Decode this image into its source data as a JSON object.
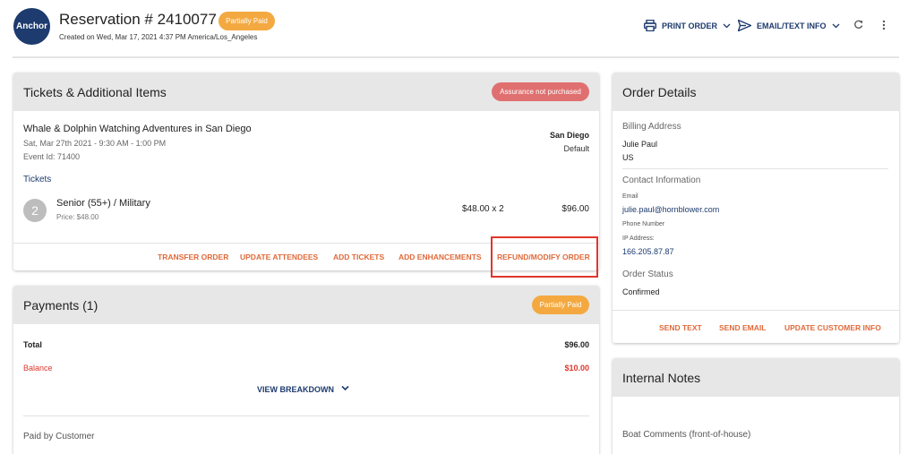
{
  "header": {
    "logo_text": "Anchor",
    "title": "Reservation # 2410077",
    "status_badge": "Partially Paid",
    "created": "Created on Wed, Mar 17, 2021 4:37 PM America/Los_Angeles",
    "print_label": "PRINT ORDER",
    "email_label": "EMAIL/TEXT INFO"
  },
  "tickets_card": {
    "title": "Tickets & Additional Items",
    "assurance_badge": "Assurance not purchased",
    "event": {
      "name": "Whale & Dolphin Watching Adventures in San Diego",
      "date": "Sat, Mar 27th 2021 - 9:30 AM - 1:00 PM",
      "event_id": "Event Id: 71400",
      "location": "San Diego",
      "location_sub": "Default"
    },
    "tickets_label": "Tickets",
    "ticket": {
      "qty": "2",
      "name": "Senior (55+) / Military",
      "price": "Price: $48.00",
      "unit_qty": "$48.00 x 2",
      "total": "$96.00"
    },
    "actions": {
      "transfer": "TRANSFER ORDER",
      "update_attendees": "UPDATE ATTENDEES",
      "add_tickets": "ADD TICKETS",
      "add_enhancements": "ADD ENHANCEMENTS",
      "refund_modify": "REFUND/MODIFY ORDER"
    }
  },
  "payments_card": {
    "title": "Payments (1)",
    "status_badge": "Partially Paid",
    "total_label": "Total",
    "total_value": "$96.00",
    "balance_label": "Balance",
    "balance_value": "$10.00",
    "view_breakdown": "VIEW BREAKDOWN",
    "paid_by": "Paid by Customer"
  },
  "order_card": {
    "title": "Order Details",
    "billing_label": "Billing Address",
    "billing_name": "Julie Paul",
    "billing_country": "US",
    "contact_label": "Contact Information",
    "email_label": "Email",
    "email_value": "julie.paul@hornblower.com",
    "phone_label": "Phone Number",
    "ip_label": "IP Address:",
    "ip_value": "166.205.87.87",
    "status_label": "Order Status",
    "status_value": "Confirmed",
    "actions": {
      "send_text": "SEND TEXT",
      "send_email": "SEND EMAIL",
      "update_customer": "UPDATE CUSTOMER INFO"
    }
  },
  "notes_card": {
    "title": "Internal Notes",
    "boat_comments": "Boat Comments (front-of-house)"
  },
  "colors": {
    "primary": "#1d3b6e",
    "accent": "#e06a3a",
    "paid_badge": "#f4a940",
    "assurance_badge": "#e07070",
    "balance": "#e0362c"
  }
}
